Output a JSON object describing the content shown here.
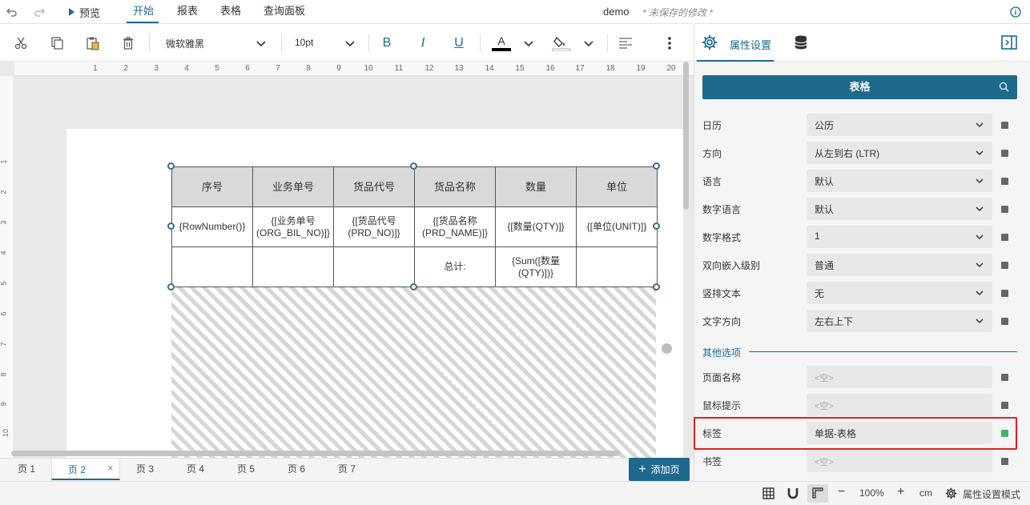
{
  "topbar": {
    "undo": "undo-icon",
    "redo": "redo-icon",
    "preview": "预览",
    "tabs": [
      "开始",
      "报表",
      "表格",
      "查询面板"
    ],
    "doc_name": "demo",
    "unsaved": "* 未保存的修改 *",
    "info": "info-icon"
  },
  "ribbon": {
    "font_name": "微软雅黑",
    "font_size": "10pt",
    "bold": "B",
    "italic": "I",
    "underline": "U",
    "font_color_letter": "A"
  },
  "ruler": {
    "h_ticks": [
      "1",
      "2",
      "3",
      "4",
      "5",
      "6",
      "7",
      "8",
      "9",
      "10",
      "11",
      "12",
      "13",
      "14",
      "15",
      "16",
      "17",
      "18",
      "19",
      "20"
    ],
    "v_ticks": [
      "1",
      "2",
      "3",
      "4",
      "5",
      "6",
      "7",
      "8",
      "9",
      "10"
    ]
  },
  "table": {
    "headers": [
      "序号",
      "业务单号",
      "货品代号",
      "货品名称",
      "数量",
      "单位"
    ],
    "row2": [
      "{RowNumber()}",
      "{[业务单号(ORG_BIL_NO)]}",
      "{[货品代号(PRD_NO)]}",
      "{[货品名称(PRD_NAME)]}",
      "{[数量(QTY)]}",
      "{[单位(UNIT)]}"
    ],
    "row3": [
      "",
      "",
      "",
      "总计:",
      "{Sum([数量(QTY)])}",
      ""
    ]
  },
  "pages": {
    "tabs": [
      "页 1",
      "页 2",
      "页 3",
      "页 4",
      "页 5",
      "页 6",
      "页 7"
    ],
    "active_index": 1,
    "add_page": "添加页"
  },
  "panel": {
    "tab_label": "属性设置",
    "search_title": "表格",
    "properties": [
      {
        "label": "日历",
        "value": "公历",
        "dropdown": true
      },
      {
        "label": "方向",
        "value": "从左到右 (LTR)",
        "dropdown": true
      },
      {
        "label": "语言",
        "value": "默认",
        "dropdown": true
      },
      {
        "label": "数字语言",
        "value": "默认",
        "dropdown": true
      },
      {
        "label": "数字格式",
        "value": "1",
        "dropdown": true
      },
      {
        "label": "双向嵌入级别",
        "value": "普通",
        "dropdown": true
      },
      {
        "label": "竖排文本",
        "value": "无",
        "dropdown": true
      },
      {
        "label": "文字方向",
        "value": "左右上下",
        "dropdown": true
      }
    ],
    "group_label": "其他选项",
    "other": [
      {
        "label": "页面名称",
        "value": "<空>",
        "placeholder": true
      },
      {
        "label": "鼠标提示",
        "value": "<空>",
        "placeholder": true
      },
      {
        "label": "标签",
        "value": "单据-表格",
        "placeholder": false,
        "dot_color": "#3cb371"
      },
      {
        "label": "书签",
        "value": "<空>",
        "placeholder": true
      }
    ]
  },
  "status": {
    "zoom": "100%",
    "unit": "cm",
    "mode": "属性设置模式"
  },
  "colors": {
    "accent": "#1e6a8d",
    "highlight_border": "#e02020",
    "status_green": "#3cb371"
  }
}
